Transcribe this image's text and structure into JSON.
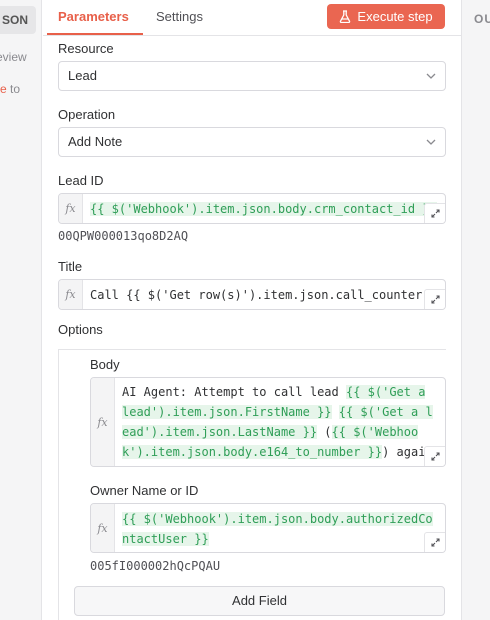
{
  "left_panel": {
    "json_button": "SON",
    "preview_text": "eview",
    "note_highlight": "e",
    "note_rest": " to"
  },
  "right_panel": {
    "label": "OU"
  },
  "tabs": [
    {
      "label": "Parameters",
      "active": true
    },
    {
      "label": "Settings",
      "active": false
    }
  ],
  "execute_button": {
    "label": "Execute step",
    "icon": "flask-icon"
  },
  "resource": {
    "label": "Resource",
    "value": "Lead"
  },
  "operation": {
    "label": "Operation",
    "value": "Add Note"
  },
  "lead_id": {
    "label": "Lead ID",
    "expression": "{{ $('Webhook').item.json.body.crm_contact_id }}",
    "resolved": "00QPW000013qo8D2AQ"
  },
  "title": {
    "label": "Title",
    "prefix": "Call ",
    "expression": "{{ $('Get row(s)').item.json.call_counter }}"
  },
  "options": {
    "label": "Options",
    "body": {
      "label": "Body",
      "text1": "AI Agent: Attempt to call lead ",
      "expr1": "{{ $('Get a lead').item.json.FirstName }}",
      "text2": " ",
      "expr2": "{{ $('Get a lead').item.json.LastName }}",
      "text3": " (",
      "expr3": "{{ $('Webhook').item.json.body.e164_to_number }}",
      "text4": ") again."
    },
    "owner": {
      "label": "Owner Name or ID",
      "expression": "{{ $('Webhook').item.json.body.authorizedContactUser }}",
      "resolved": "005fI000002hQcPQAU"
    }
  },
  "add_field_button": "Add Field",
  "colors": {
    "accent": "#ea6651",
    "expression_green": "#2f9e57"
  }
}
